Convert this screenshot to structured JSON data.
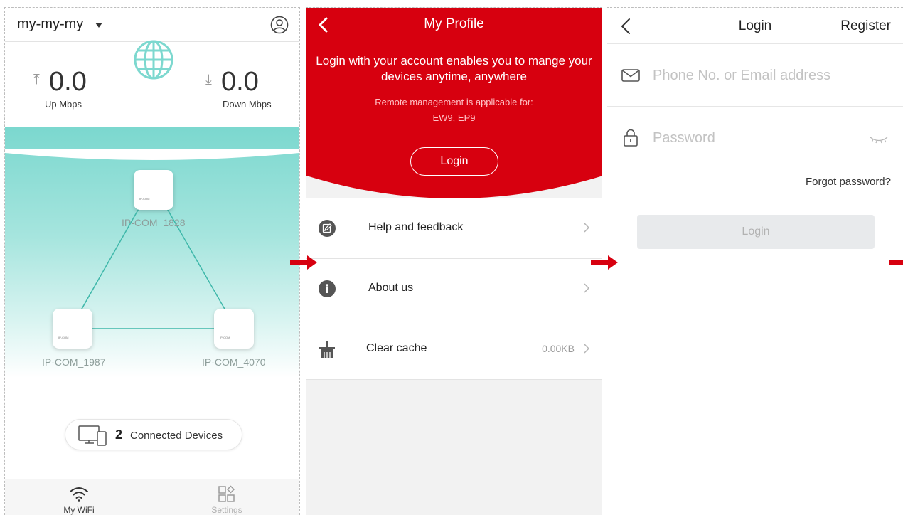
{
  "wifi_screen": {
    "network_name": "my-my-my",
    "up": {
      "value": "0.0",
      "label": "Up Mbps"
    },
    "down": {
      "value": "0.0",
      "label": "Down Mbps"
    },
    "nodes": [
      {
        "label": "IP-COM_1828",
        "brand": "IP-COM"
      },
      {
        "label": "IP-COM_1987",
        "brand": "IP-COM"
      },
      {
        "label": "IP-COM_4070",
        "brand": "IP-COM"
      }
    ],
    "devices": {
      "count": "2",
      "label": "Connected Devices"
    },
    "tabs": [
      {
        "label": "My WiFi",
        "icon": "wifi-icon",
        "active": true
      },
      {
        "label": "Settings",
        "icon": "settings-grid-icon",
        "active": false
      }
    ],
    "accent_color": "#7dd8cf"
  },
  "profile_screen": {
    "title": "My Profile",
    "intro": "Login with your account enables you to mange your devices anytime, anywhere",
    "note_line1": "Remote management is applicable for:",
    "note_line2": "EW9, EP9",
    "login_label": "Login",
    "menu": [
      {
        "label": "Help and feedback",
        "icon": "edit-icon",
        "value": ""
      },
      {
        "label": "About us",
        "icon": "info-icon",
        "value": ""
      },
      {
        "label": "Clear cache",
        "icon": "broom-icon",
        "value": "0.00KB"
      }
    ],
    "brand_color": "#d7000f"
  },
  "login_screen": {
    "title": "Login",
    "register_label": "Register",
    "phone_placeholder": "Phone No. or Email address",
    "password_placeholder": "Password",
    "forgot_label": "Forgot password?",
    "login_label": "Login"
  },
  "arrow_color": "#d7000f"
}
